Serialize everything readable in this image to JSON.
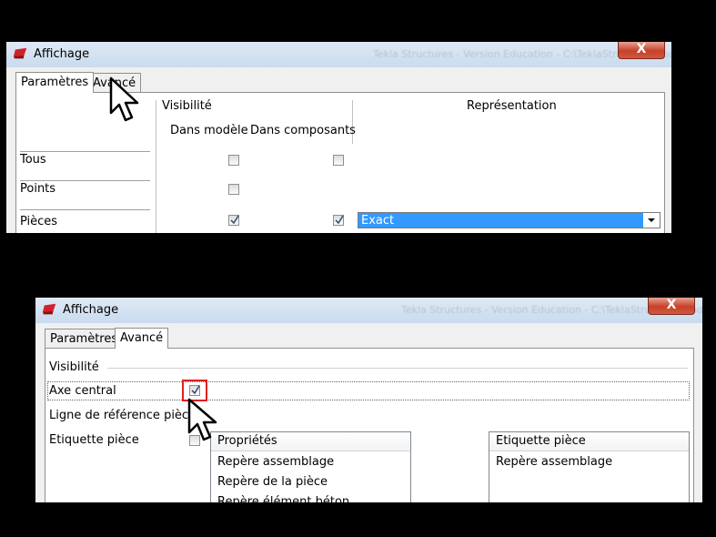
{
  "panel_top": {
    "window_title": "Affichage",
    "title_ghost": "Tekla Structures - Version Education - C:\\TeklaStructuresModels",
    "close_glyph": "X",
    "tabs": [
      {
        "label": "Paramètres",
        "active": true
      },
      {
        "label": "Avancé",
        "active": false
      }
    ],
    "column_groups": {
      "visibility": "Visibilité",
      "representation": "Représentation"
    },
    "columns": {
      "in_model": "Dans modèle",
      "in_components": "Dans composants"
    },
    "rows": [
      {
        "label": "Tous",
        "model_checked": false,
        "components_checked": false
      },
      {
        "label": "Points",
        "model_checked": false
      },
      {
        "label": "Pièces",
        "model_checked": true,
        "components_checked": true,
        "representation": "Exact"
      }
    ]
  },
  "panel_bottom": {
    "window_title": "Affichage",
    "title_ghost": "Tekla Structures - Version Education - C:\\TeklaStructuresModels",
    "close_glyph": "X",
    "tabs": [
      {
        "label": "Paramètres",
        "active": false
      },
      {
        "label": "Avancé",
        "active": true
      }
    ],
    "section_label": "Visibilité",
    "options": [
      {
        "label": "Axe central",
        "checked": true,
        "highlighted": true
      },
      {
        "label": "Ligne de référence pièce",
        "checked": false
      },
      {
        "label": "Etiquette pièce",
        "checked": false
      }
    ],
    "properties_list": {
      "header": "Propriétés",
      "items": [
        "Repère assemblage",
        "Repère de la pièce",
        "Repère élément béton"
      ]
    },
    "label_list": {
      "header": "Etiquette pièce",
      "items": [
        "Repère assemblage"
      ]
    }
  },
  "colors": {
    "highlight_box": "#e02020",
    "selection": "#3399ff",
    "titlebar": "#c9dbee",
    "close_button": "#c7412b"
  },
  "icons": [
    "app-icon",
    "close-icon",
    "mouse-pointer-icon",
    "checkmark-icon",
    "dropdown-arrow-icon"
  ]
}
